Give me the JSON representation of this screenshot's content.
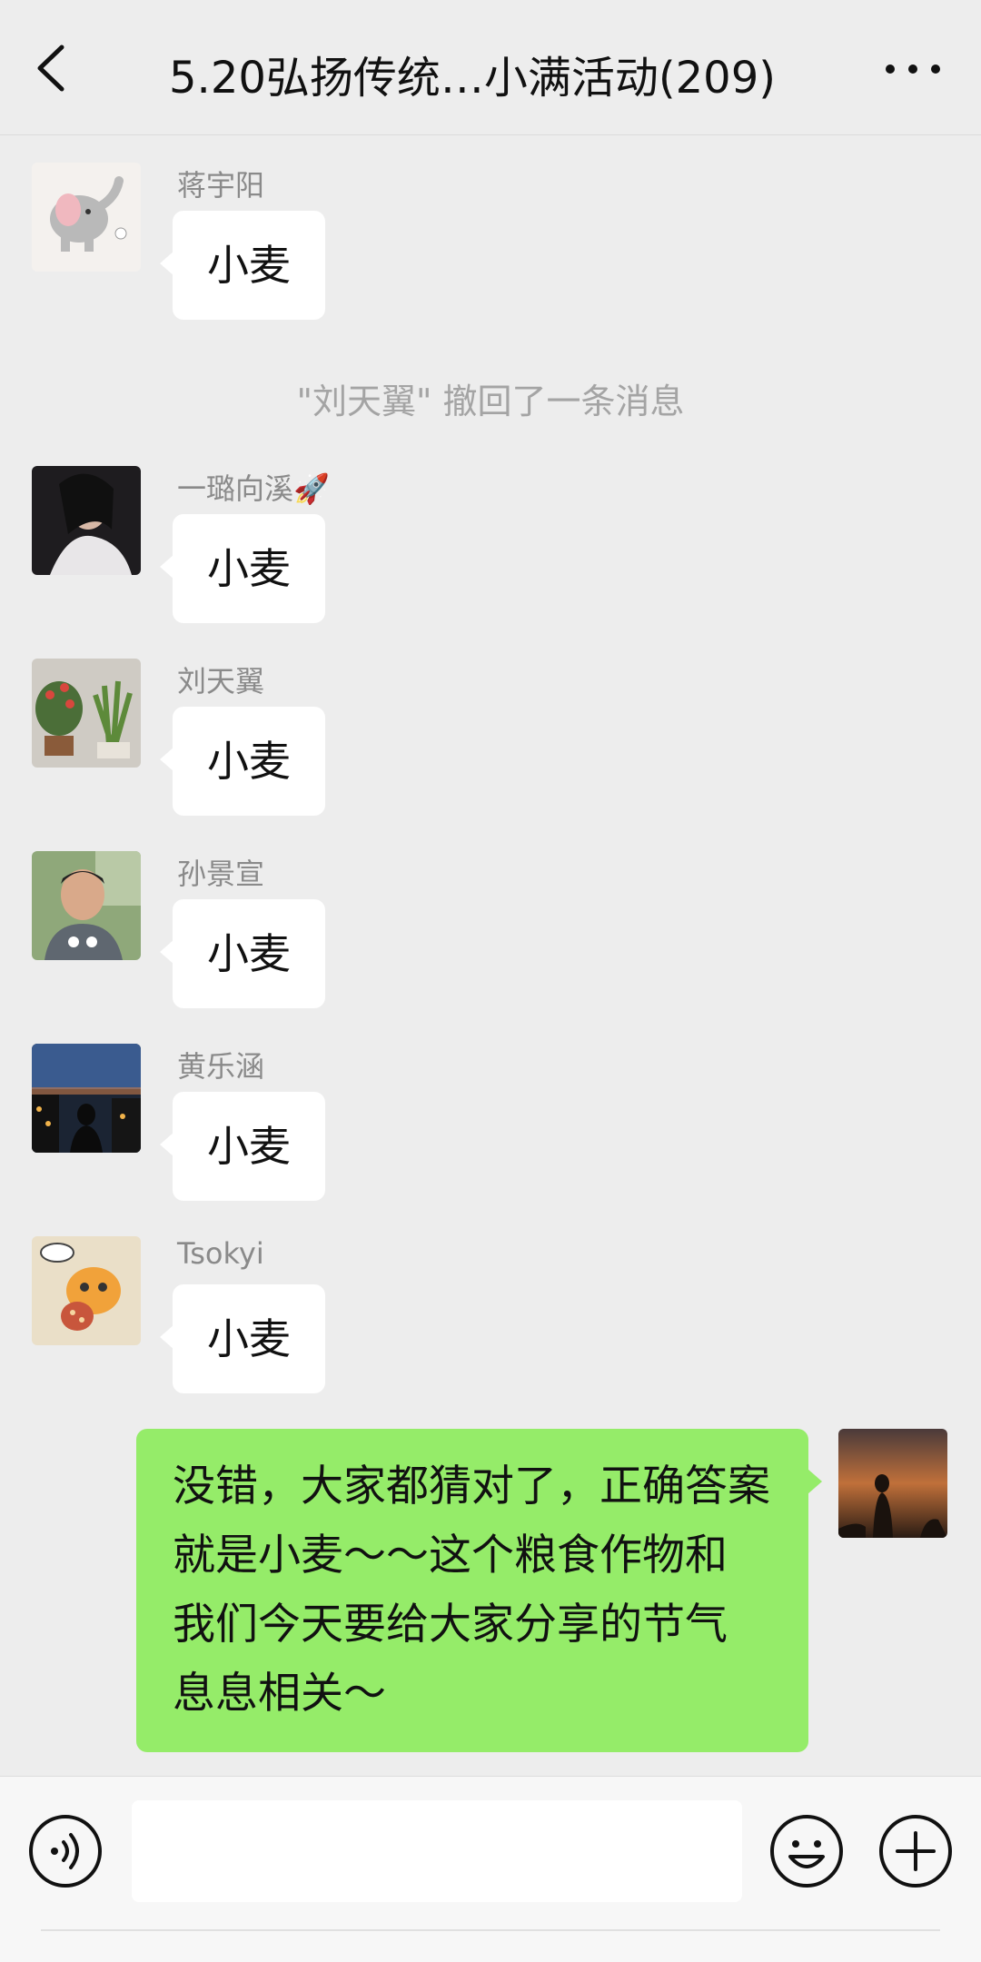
{
  "header": {
    "title": "5.20弘扬传统…小满活动(209)",
    "back_icon": "chevron-left-icon",
    "more_icon": "more-dots-icon"
  },
  "messages": [
    {
      "sender": "蒋宇阳",
      "text": "小麦",
      "avatar": "elephant-avatar"
    },
    {
      "sender": "一璐向溪🚀",
      "text": "小麦",
      "avatar": "girl-avatar"
    },
    {
      "sender": "刘天翼",
      "text": "小麦",
      "avatar": "plants-avatar"
    },
    {
      "sender": "孙景宣",
      "text": "小麦",
      "avatar": "man-avatar"
    },
    {
      "sender": "黄乐涵",
      "text": "小麦",
      "avatar": "night-city-avatar"
    },
    {
      "sender": "Tsokyi",
      "text": "小麦",
      "avatar": "cartoon-avatar"
    }
  ],
  "system_note": "\"刘天翼\" 撤回了一条消息",
  "outgoing": {
    "lines": [
      "没错，大家都猜对了，正确答案",
      "就是小麦～～这个粮食作物和",
      "我们今天要给大家分享的节气",
      "息息相关～"
    ],
    "avatar": "sunset-silhouette-avatar"
  },
  "input_bar": {
    "voice_icon": "voice-icon",
    "emoji_icon": "emoji-icon",
    "plus_icon": "plus-icon",
    "placeholder": ""
  },
  "colors": {
    "background": "#ededed",
    "incoming_bubble": "#ffffff",
    "outgoing_bubble": "#95ec69",
    "meta_text": "#8a8a8a"
  }
}
